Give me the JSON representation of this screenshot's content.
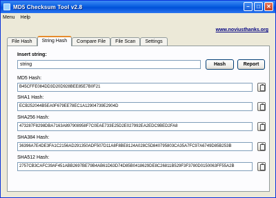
{
  "window": {
    "title": "MD5 Checksum Tool v2.8"
  },
  "menu": [
    "Menu",
    "Help"
  ],
  "website": "www.noviusthanks.org",
  "tabs": [
    "File Hash",
    "String Hash",
    "Compare File",
    "File Scan",
    "Settings"
  ],
  "active_tab": "String Hash",
  "input": {
    "label": "Insert string:",
    "value": "string"
  },
  "buttons": {
    "hash": "Hash",
    "report": "Report"
  },
  "hashes": [
    {
      "label": "MD5 Hash:",
      "value": "B45CFFE084DD3D20D928BEE85E7B0F21"
    },
    {
      "label": "SHA1 Hash:",
      "value": "ECB252044B5EA0F679EE78EC1A12904739E2904D"
    },
    {
      "label": "SHA256 Hash:",
      "value": "473287F8298DBA7163A897908958F7C0EAE733E25D2E027992EA2EDC9BED2FA8"
    },
    {
      "label": "SHA384 Hash:",
      "value": "36396A7E4DE3FA1C2156AD291350ADF507D11A8F8BE8124A028C5D840795803CA35A7FC97A6749D85B253B"
    },
    {
      "label": "SHA512 Hash:",
      "value": "2757CB3CAFC39AF451ABB2697BE79B4AB61D63D74D85B0418629DE8C26811B529F3F3780D0150063FF55A2B"
    }
  ]
}
